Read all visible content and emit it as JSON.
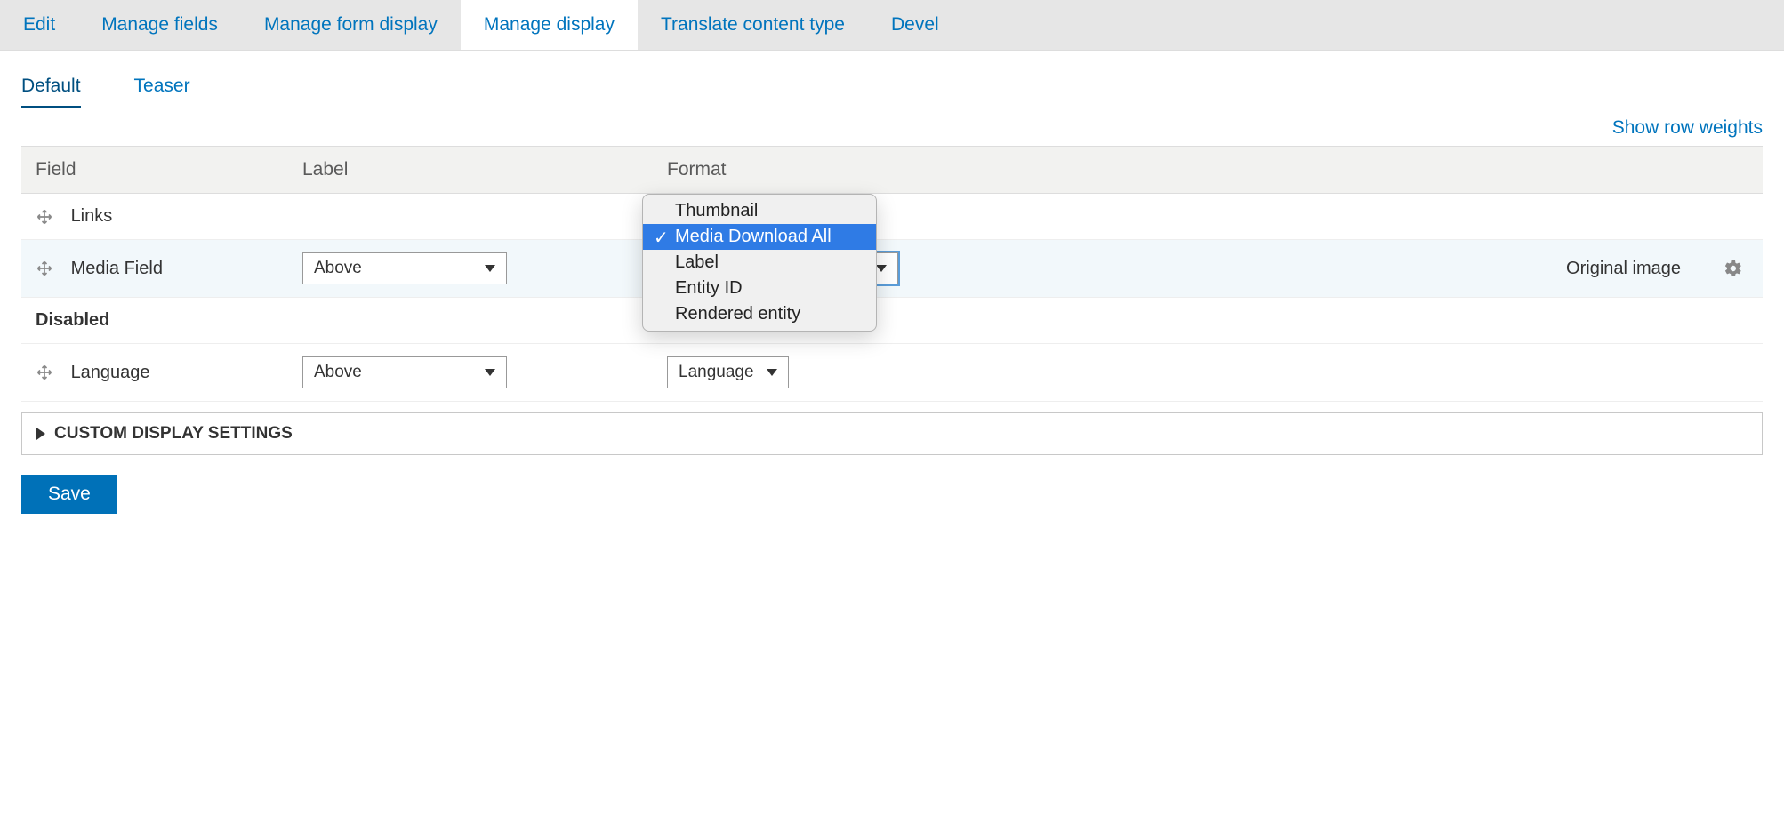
{
  "primary_tabs": {
    "edit": "Edit",
    "manage_fields": "Manage fields",
    "manage_form_display": "Manage form display",
    "manage_display": "Manage display",
    "translate": "Translate content type",
    "devel": "Devel"
  },
  "secondary_tabs": {
    "default": "Default",
    "teaser": "Teaser"
  },
  "links": {
    "show_row_weights": "Show row weights"
  },
  "table": {
    "headers": {
      "field": "Field",
      "label": "Label",
      "format": "Format"
    },
    "rows": {
      "links": {
        "field": "Links"
      },
      "media_field": {
        "field": "Media Field",
        "label_select": "Above",
        "summary": "Original image"
      },
      "disabled_region": "Disabled",
      "language": {
        "field": "Language",
        "label_select": "Above",
        "format_select": "Language"
      }
    }
  },
  "format_dropdown": {
    "options": {
      "thumbnail": "Thumbnail",
      "media_download_all": "Media Download All",
      "label": "Label",
      "entity_id": "Entity ID",
      "rendered_entity": "Rendered entity"
    }
  },
  "custom_display_settings": "CUSTOM DISPLAY SETTINGS",
  "buttons": {
    "save": "Save"
  }
}
